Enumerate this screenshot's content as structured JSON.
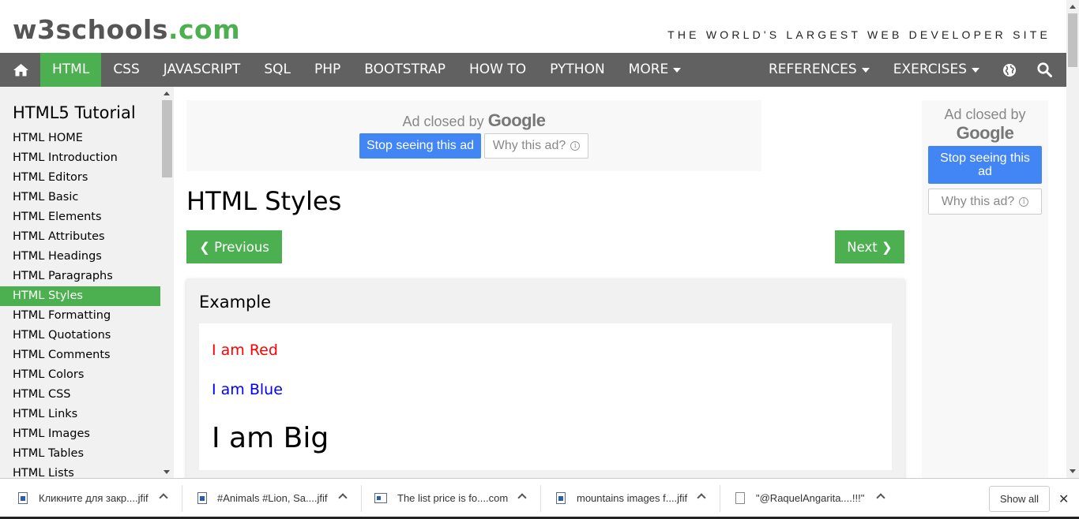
{
  "logo": {
    "main": "w3schools",
    "suffix": ".com"
  },
  "tagline": "THE WORLD'S LARGEST WEB DEVELOPER SITE",
  "nav": {
    "left": [
      "HTML",
      "CSS",
      "JAVASCRIPT",
      "SQL",
      "PHP",
      "BOOTSTRAP",
      "HOW TO",
      "PYTHON"
    ],
    "more": "MORE",
    "references": "REFERENCES",
    "exercises": "EXERCISES",
    "active": "HTML"
  },
  "sidebar": {
    "title": "HTML5 Tutorial",
    "items": [
      "HTML HOME",
      "HTML Introduction",
      "HTML Editors",
      "HTML Basic",
      "HTML Elements",
      "HTML Attributes",
      "HTML Headings",
      "HTML Paragraphs",
      "HTML Styles",
      "HTML Formatting",
      "HTML Quotations",
      "HTML Comments",
      "HTML Colors",
      "HTML CSS",
      "HTML Links",
      "HTML Images",
      "HTML Tables",
      "HTML Lists"
    ],
    "active": "HTML Styles"
  },
  "ad_top": {
    "closed_text": "Ad closed by",
    "brand": "Google",
    "stop": "Stop seeing this ad",
    "why": "Why this ad?"
  },
  "ad_side": {
    "closed_text": "Ad closed by",
    "brand": "Google",
    "stop": "Stop seeing this ad",
    "why": "Why this ad?"
  },
  "main": {
    "title": "HTML Styles",
    "prev": "❮ Previous",
    "next": "Next ❯",
    "example": {
      "heading": "Example",
      "red": "I am Red",
      "blue": "I am Blue",
      "big": "I am Big"
    }
  },
  "downloads": {
    "items": [
      {
        "name": "Кликните для закр....jfif",
        "icon": "image-file-icon"
      },
      {
        "name": "#Animals #Lion, Sa....jfif",
        "icon": "image-file-icon"
      },
      {
        "name": "The list price is fo....com",
        "icon": "web-file-icon"
      },
      {
        "name": "mountains images f....jfif",
        "icon": "image-file-icon"
      },
      {
        "name": "\"@RaquelAngarita....!!!\"",
        "icon": "document-file-icon"
      }
    ],
    "show_all": "Show all"
  }
}
